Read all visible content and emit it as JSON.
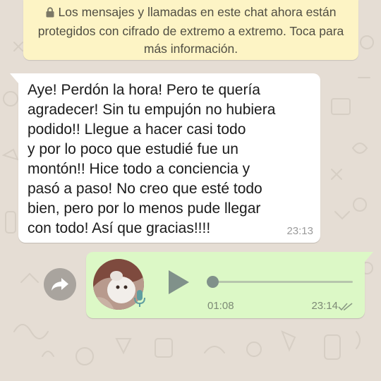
{
  "notice": {
    "text": "Los mensajes y llamadas en este chat ahora están protegidos con cifrado de extremo a extremo. Toca para más información."
  },
  "incoming_message": {
    "text": "Aye! Perdón la hora! Pero te quería\nagradecer! Sin tu empujón no hubiera\npodido!! Llegue a hacer casi todo\ny por lo poco que estudié fue un\nmontón!! Hice todo a conciencia y\npasó a paso! No creo que esté todo\nbien, pero por lo menos pude llegar\ncon todo! Así que gracias!!!!",
    "time": "23:13"
  },
  "voice_message": {
    "duration": "01:08",
    "time": "23:14",
    "progress": 0.0
  },
  "colors": {
    "wallpaper": "#e5ddd4",
    "notice_bg": "#fdf4c5",
    "incoming_bg": "#ffffff",
    "outgoing_bg": "#dcf8c6",
    "play_icon": "#80918a",
    "mic_icon": "#5f9ea0"
  },
  "icons": [
    "lock-icon",
    "forward-icon",
    "play-icon",
    "mic-icon",
    "double-check-icon"
  ]
}
